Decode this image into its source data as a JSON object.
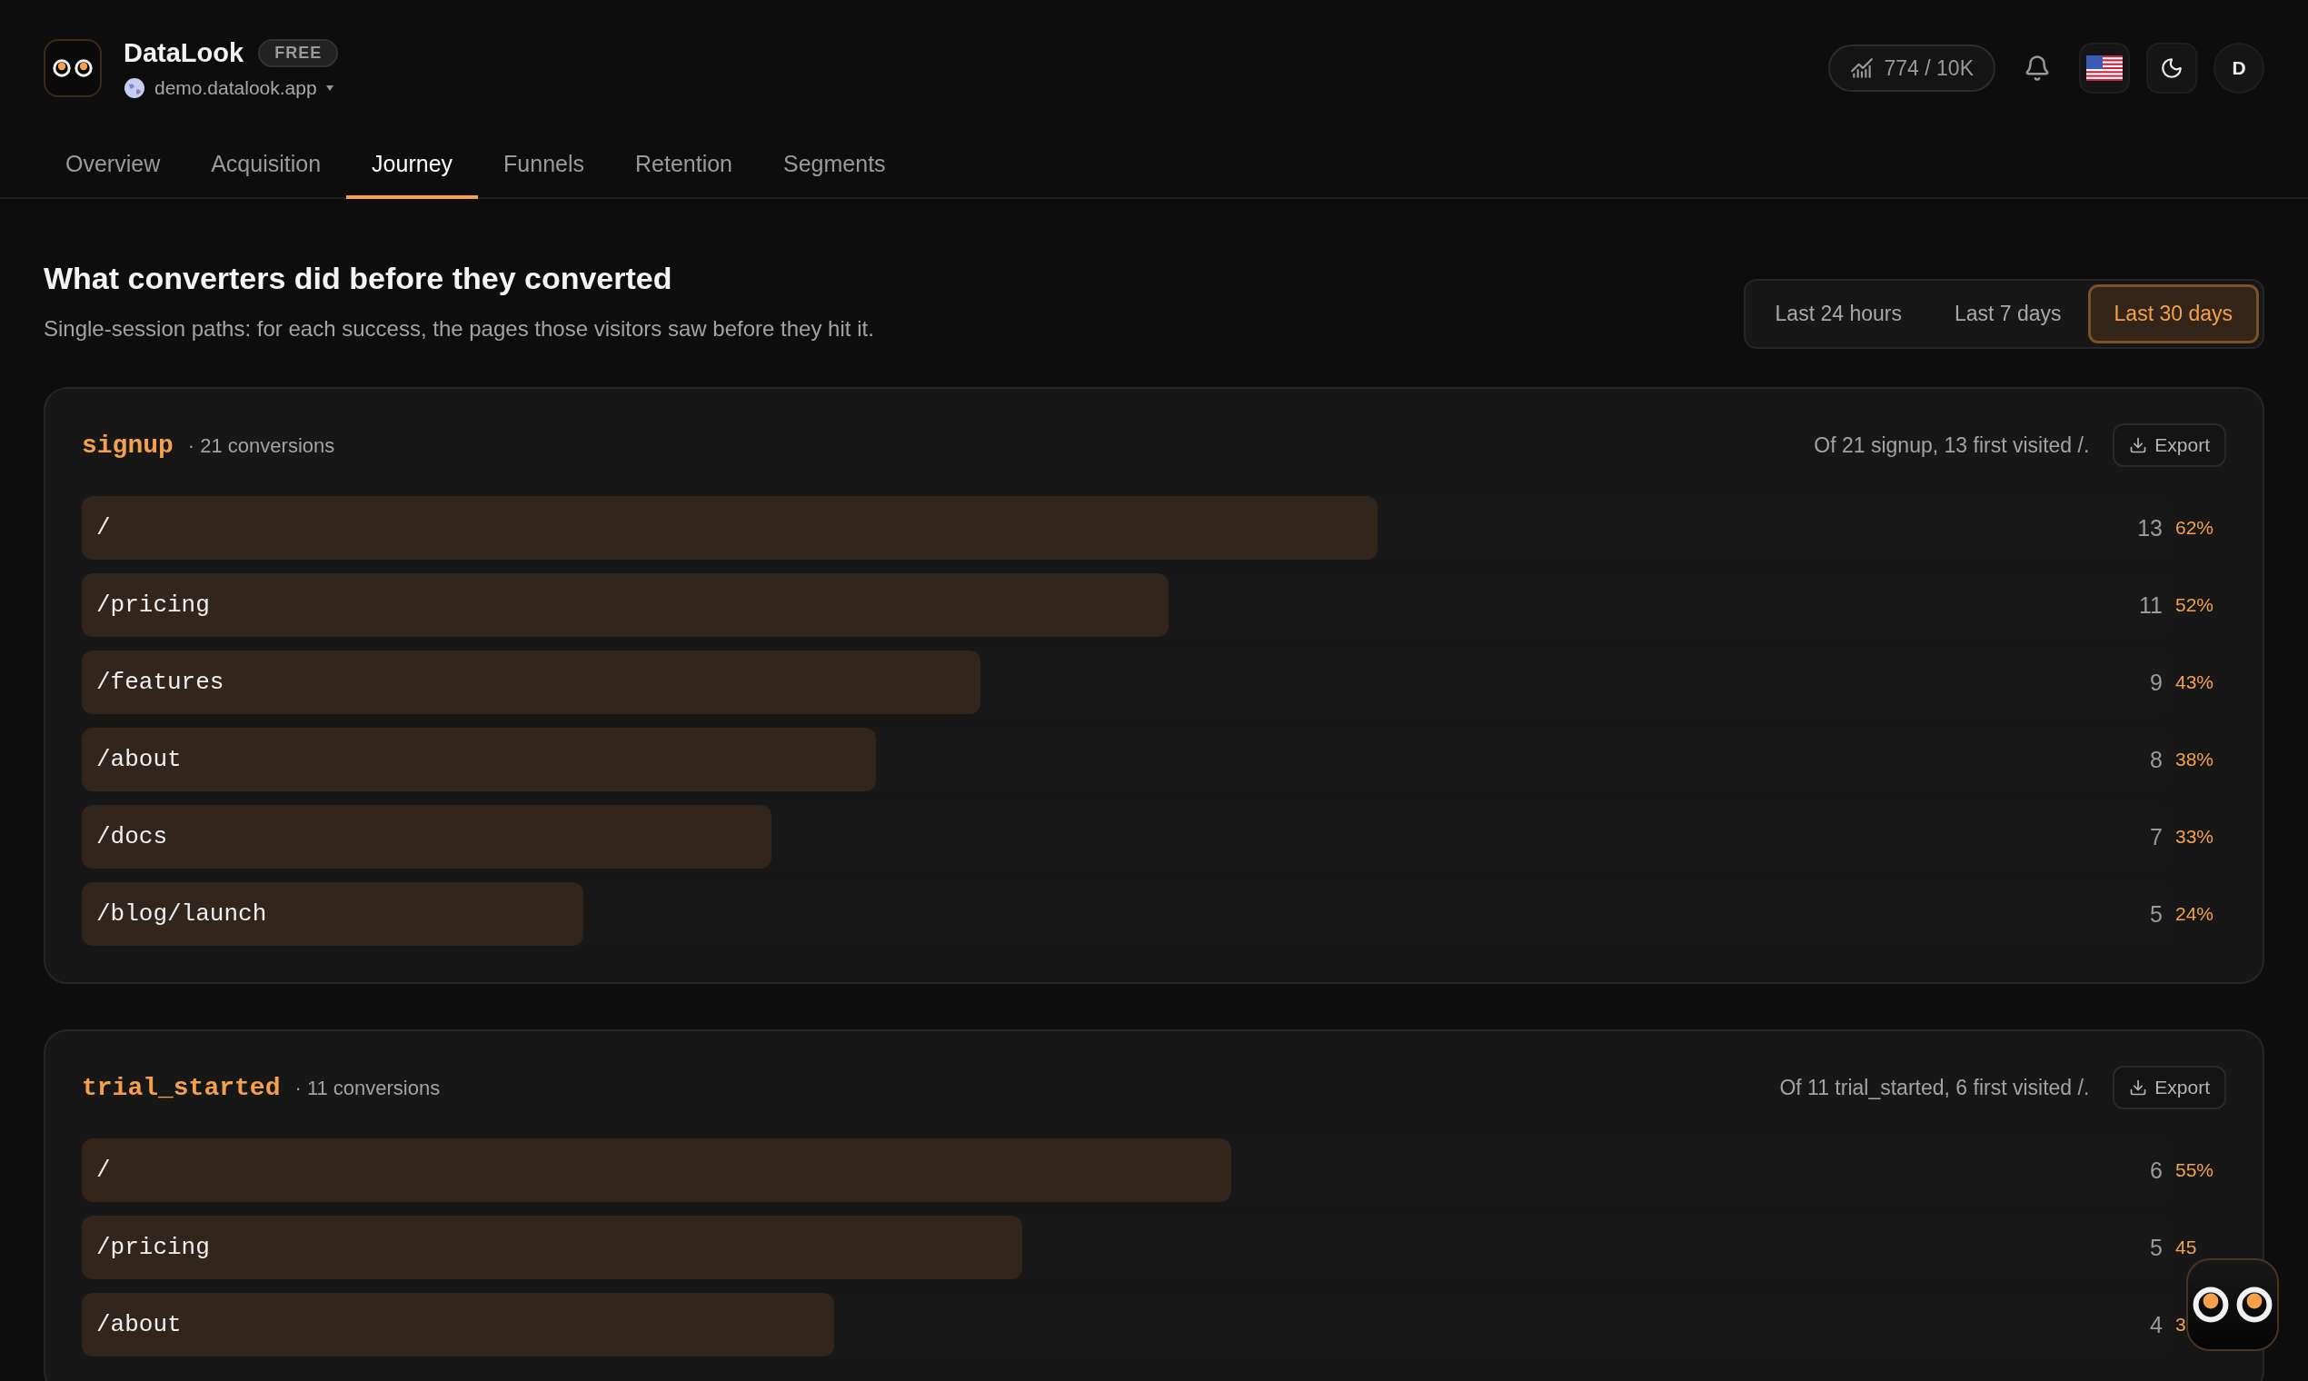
{
  "app": {
    "name": "DataLook",
    "plan_badge": "FREE",
    "site": "demo.datalook.app"
  },
  "header": {
    "usage": "774 / 10K",
    "avatar": "D"
  },
  "tabs": [
    {
      "label": "Overview",
      "selected": false
    },
    {
      "label": "Acquisition",
      "selected": false
    },
    {
      "label": "Journey",
      "selected": true
    },
    {
      "label": "Funnels",
      "selected": false
    },
    {
      "label": "Retention",
      "selected": false
    },
    {
      "label": "Segments",
      "selected": false
    }
  ],
  "page": {
    "title": "What converters did before they converted",
    "subtitle": "Single-session paths: for each success, the pages those visitors saw before they hit it."
  },
  "ranges": [
    {
      "label": "Last 24 hours",
      "selected": false
    },
    {
      "label": "Last 7 days",
      "selected": false
    },
    {
      "label": "Last 30 days",
      "selected": true
    }
  ],
  "goals": [
    {
      "event": "signup",
      "conversions": "· 21 conversions",
      "summary": "Of 21 signup, 13 first visited /.",
      "export": "Export",
      "pages": [
        {
          "path": "/",
          "count": "13",
          "percent": "62%",
          "level": 0.62
        },
        {
          "path": "/pricing",
          "count": "11",
          "percent": "52%",
          "level": 0.52
        },
        {
          "path": "/features",
          "count": "9",
          "percent": "43%",
          "level": 0.43
        },
        {
          "path": "/about",
          "count": "8",
          "percent": "38%",
          "level": 0.38
        },
        {
          "path": "/docs",
          "count": "7",
          "percent": "33%",
          "level": 0.33
        },
        {
          "path": "/blog/launch",
          "count": "5",
          "percent": "24%",
          "level": 0.24
        }
      ]
    },
    {
      "event": "trial_started",
      "conversions": "· 11 conversions",
      "summary": "Of 11 trial_started, 6 first visited /.",
      "export": "Export",
      "pages": [
        {
          "path": "/",
          "count": "6",
          "percent": "55%",
          "level": 0.55
        },
        {
          "path": "/pricing",
          "count": "5",
          "percent": "45",
          "level": 0.45
        },
        {
          "path": "/about",
          "count": "4",
          "percent": "3",
          "level": 0.36
        }
      ]
    }
  ]
}
